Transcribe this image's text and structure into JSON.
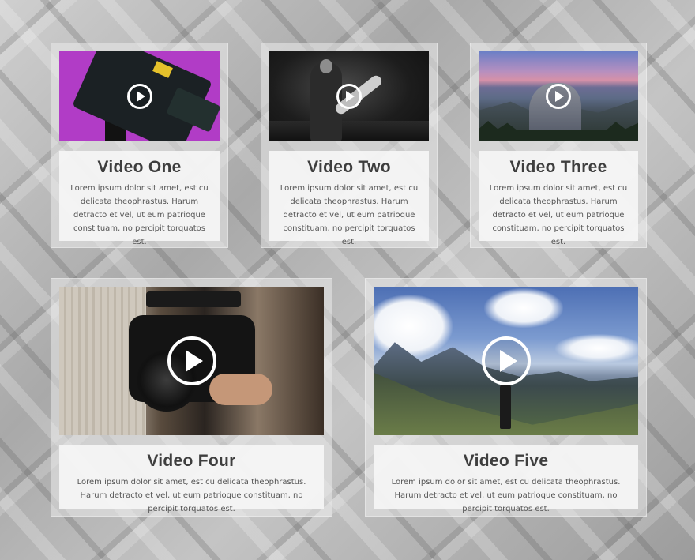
{
  "cards": [
    {
      "title": "Video One",
      "description": "Lorem ipsum dolor sit amet, est cu delicata theophrastus. Harum detracto et vel, ut eum patrioque constituam, no percipit torquatos est.",
      "thumbnail_icon": "camera-rig-on-purple",
      "play_icon": "play-icon"
    },
    {
      "title": "Video Two",
      "description": "Lorem ipsum dolor sit amet, est cu delicata theophrastus. Harum detracto et vel, ut eum patrioque constituam, no percipit torquatos est.",
      "thumbnail_icon": "guitarist-on-stage",
      "play_icon": "play-icon"
    },
    {
      "title": "Video Three",
      "description": "Lorem ipsum dolor sit amet, est cu delicata theophrastus. Harum detracto et vel, ut eum patrioque constituam, no percipit torquatos est.",
      "thumbnail_icon": "mountain-sunset",
      "play_icon": "play-icon"
    },
    {
      "title": "Video Four",
      "description": "Lorem ipsum dolor sit amet, est cu delicata theophrastus. Harum detracto et vel, ut eum patrioque constituam, no percipit torquatos est.",
      "thumbnail_icon": "video-camera-closeup",
      "play_icon": "play-icon"
    },
    {
      "title": "Video Five",
      "description": "Lorem ipsum dolor sit amet, est cu delicata theophrastus. Harum detracto et vel, ut eum patrioque constituam, no percipit torquatos est.",
      "thumbnail_icon": "hiker-on-mountain",
      "play_icon": "play-icon"
    }
  ],
  "colors": {
    "title_text": "#3e3e3e",
    "body_text": "#555555",
    "card_background": "#f5f5f5",
    "play_icon": "#ffffff"
  }
}
